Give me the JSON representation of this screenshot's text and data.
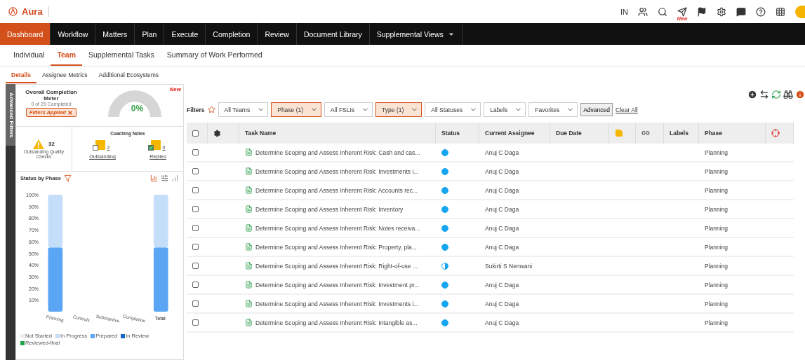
{
  "app": {
    "logo": "Aura"
  },
  "header": {
    "region": "IN",
    "new_badge": "New"
  },
  "nav": [
    {
      "label": "Dashboard",
      "selected": true
    },
    {
      "label": "Workflow",
      "selected": false
    },
    {
      "label": "Matters",
      "selected": false
    },
    {
      "label": "Plan",
      "selected": false
    },
    {
      "label": "Execute",
      "selected": false
    },
    {
      "label": "Completion",
      "selected": false
    },
    {
      "label": "Review",
      "selected": false
    },
    {
      "label": "Document Library",
      "selected": false
    },
    {
      "label": "Supplemental Views",
      "selected": false,
      "dropdown": true
    }
  ],
  "tabs": [
    {
      "label": "Individual",
      "selected": false
    },
    {
      "label": "Team",
      "selected": true
    },
    {
      "label": "Supplemental Tasks",
      "selected": false
    },
    {
      "label": "Summary of Work Performed",
      "selected": false
    }
  ],
  "subtabs": [
    {
      "label": "Details",
      "selected": true
    },
    {
      "label": "Assignee Metrics",
      "selected": false
    },
    {
      "label": "Additional Ecosystems",
      "selected": false
    }
  ],
  "side_toggle": "Advanced Filters",
  "meter": {
    "title": "Overall Completion Meter",
    "subtitle": "0 of 29 Completed",
    "filter_chip": "Filters Applied",
    "gauge_value": "0%",
    "badge": "New"
  },
  "quality": {
    "count": "32",
    "label": "Outstanding Quality Checks"
  },
  "coaching": {
    "title": "Coaching Notes",
    "items": [
      {
        "count": "2",
        "label": "Outstanding",
        "checked": false
      },
      {
        "count": "0",
        "label": "Replied",
        "checked": true
      }
    ]
  },
  "status_by_phase": {
    "title": "Status by Phase",
    "chart_data": {
      "type": "bar",
      "stacked": true,
      "categories": [
        "Planning",
        "Controls",
        "Substantive",
        "Completion",
        "Total"
      ],
      "ylim": [
        0,
        100
      ],
      "yticks": [
        {
          "value": 10,
          "label": "10%"
        },
        {
          "value": 20,
          "label": "20%"
        },
        {
          "value": 30,
          "label": "30%"
        },
        {
          "value": 40,
          "label": "40%"
        },
        {
          "value": 50,
          "label": "50%"
        },
        {
          "value": 60,
          "label": "60%"
        },
        {
          "value": 70,
          "label": "70%"
        },
        {
          "value": 80,
          "label": "80%"
        },
        {
          "value": 90,
          "label": "90%"
        },
        {
          "value": 100,
          "label": "100%"
        }
      ],
      "series": [
        {
          "name": "Not Started",
          "color": "#eeeeee",
          "values": [
            0,
            null,
            null,
            null,
            0
          ]
        },
        {
          "name": "In Progress",
          "color": "#c4defa",
          "values": [
            45,
            null,
            null,
            null,
            45
          ]
        },
        {
          "name": "Prepared",
          "color": "#5aa6f5",
          "values": [
            55,
            null,
            null,
            null,
            55
          ]
        },
        {
          "name": "In Review",
          "color": "#1565c0",
          "values": [
            0,
            null,
            null,
            null,
            0
          ]
        },
        {
          "name": "Reviewed-final",
          "color": "#1fa34a",
          "values": [
            0,
            null,
            null,
            null,
            0
          ]
        }
      ]
    }
  },
  "filters": {
    "label": "Filters",
    "dropdowns": [
      {
        "label": "All Teams",
        "active": false
      },
      {
        "label": "Phase (1)",
        "active": true
      },
      {
        "label": "All FSLIs",
        "active": false
      },
      {
        "label": "Type (1)",
        "active": true
      },
      {
        "label": "All Statuses",
        "active": false
      },
      {
        "label": "Labels",
        "active": false
      },
      {
        "label": "Favorites",
        "active": false
      }
    ],
    "advanced": "Advanced",
    "clear": "Clear All"
  },
  "table": {
    "all_checked": false,
    "columns": [
      "Task Name",
      "Status",
      "Current Assignee",
      "Due Date",
      "Labels",
      "Phase"
    ],
    "rows": [
      {
        "task": "Determine Scoping and Assess Inherent Risk: Cash and cas...",
        "in_progress": false,
        "assignee": "Anuj C Daga",
        "phase": "Planning",
        "checked": false
      },
      {
        "task": "Determine Scoping and Assess Inherent Risk: Investments i...",
        "in_progress": false,
        "assignee": "Anuj C Daga",
        "phase": "Planning",
        "checked": false
      },
      {
        "task": "Determine Scoping and Assess Inherent Risk: Accounts rec...",
        "in_progress": false,
        "assignee": "Anuj C Daga",
        "phase": "Planning",
        "checked": false
      },
      {
        "task": "Determine Scoping and Assess Inherent Risk: Inventory",
        "in_progress": false,
        "assignee": "Anuj C Daga",
        "phase": "Planning",
        "checked": false
      },
      {
        "task": "Determine Scoping and Assess Inherent Risk: Notes receiva...",
        "in_progress": false,
        "assignee": "Anuj C Daga",
        "phase": "Planning",
        "checked": false
      },
      {
        "task": "Determine Scoping and Assess Inherent Risk: Property, pla...",
        "in_progress": false,
        "assignee": "Anuj C Daga",
        "phase": "Planning",
        "checked": false
      },
      {
        "task": "Determine Scoping and Assess Inherent Risk: Right-of-use ...",
        "in_progress": true,
        "assignee": "Sukirti S Nenwani",
        "phase": "Planning",
        "checked": false
      },
      {
        "task": "Determine Scoping and Assess Inherent Risk: Investment pr...",
        "in_progress": false,
        "assignee": "Anuj C Daga",
        "phase": "Planning",
        "checked": false
      },
      {
        "task": "Determine Scoping and Assess Inherent Risk: Investments i...",
        "in_progress": false,
        "assignee": "Anuj C Daga",
        "phase": "Planning",
        "checked": false
      },
      {
        "task": "Determine Scoping and Assess Inherent Risk: Intangible as...",
        "in_progress": false,
        "assignee": "Anuj C Daga",
        "phase": "Planning",
        "checked": false
      }
    ]
  }
}
